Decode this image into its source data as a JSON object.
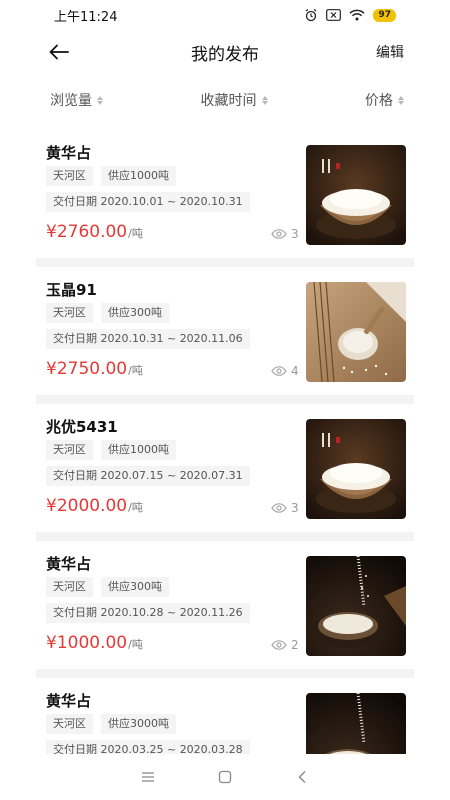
{
  "status_bar": {
    "time": "上午11:24",
    "battery": "97"
  },
  "header": {
    "title": "我的发布",
    "edit_label": "编辑"
  },
  "sort_bar": {
    "views_label": "浏览量",
    "time_label": "收藏时间",
    "price_label": "价格"
  },
  "colors": {
    "price": "#e53935",
    "tag_bg": "#f4f4f4",
    "divider": "#f3f3f3"
  },
  "items": [
    {
      "name": "黄华占",
      "district": "天河区",
      "supply": "供应1000吨",
      "date": "交付日期 2020.10.01 ~ 2020.10.31",
      "price": "¥2760.00",
      "unit": "/吨",
      "views": "3",
      "image": "rice-bowl-image"
    },
    {
      "name": "玉晶91",
      "district": "天河区",
      "supply": "供应300吨",
      "date": "交付日期 2020.10.31 ~ 2020.11.06",
      "price": "¥2750.00",
      "unit": "/吨",
      "views": "4",
      "image": "rice-spoon-image"
    },
    {
      "name": "兆优5431",
      "district": "天河区",
      "supply": "供应1000吨",
      "date": "交付日期 2020.07.15 ~ 2020.07.31",
      "price": "¥2000.00",
      "unit": "/吨",
      "views": "3",
      "image": "rice-bowl-image"
    },
    {
      "name": "黄华占",
      "district": "天河区",
      "supply": "供应300吨",
      "date": "交付日期 2020.10.28 ~ 2020.11.26",
      "price": "¥1000.00",
      "unit": "/吨",
      "views": "2",
      "image": "rice-pour-image"
    },
    {
      "name": "黄华占",
      "district": "天河区",
      "supply": "供应3000吨",
      "date": "交付日期 2020.03.25 ~ 2020.03.28",
      "price": "",
      "unit": "",
      "views": "",
      "image": "rice-pour-image"
    }
  ]
}
